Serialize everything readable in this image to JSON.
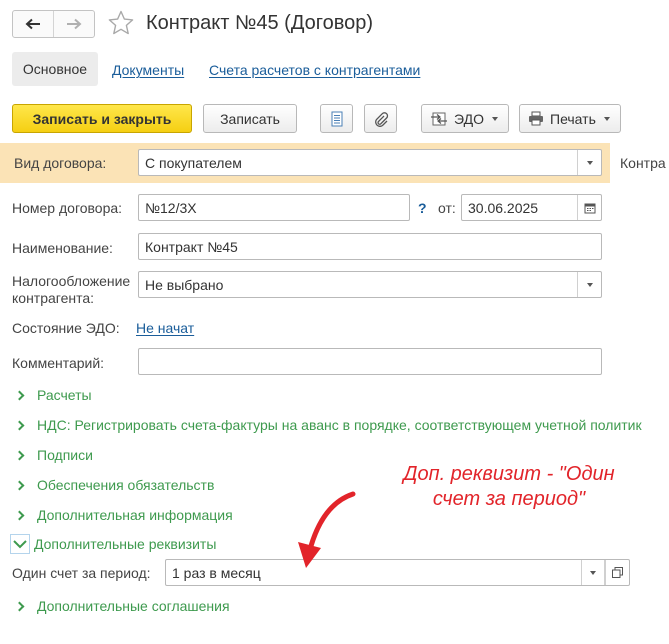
{
  "header": {
    "title": "Контракт №45 (Договор)",
    "back_icon": "arrow-left-icon",
    "forward_icon": "arrow-right-icon",
    "favorite_icon": "star-icon"
  },
  "tabs": [
    {
      "label": "Основное",
      "active": true
    },
    {
      "label": "Документы",
      "active": false
    },
    {
      "label": "Счета расчетов с контрагентами",
      "active": false
    }
  ],
  "toolbar": {
    "save_close_label": "Записать и закрыть",
    "save_label": "Записать",
    "edo_label": "ЭДО",
    "print_label": "Печать",
    "accent_color": "#f5cf12"
  },
  "form": {
    "contract_type_label": "Вид договора:",
    "contract_type_value": "С покупателем",
    "counterparty_label_cut": "Контра",
    "number_label": "Номер договора:",
    "number_value": "№12/3Х",
    "help_mark": "?",
    "date_label": "от:",
    "date_value": "30.06.2025",
    "name_label": "Наименование:",
    "name_value": "Контракт №45",
    "tax_label_line1": "Налогообложение",
    "tax_label_line2": "контрагента:",
    "tax_value": "Не выбрано",
    "edo_state_label": "Состояние ЭДО:",
    "edo_state_value": "Не начат",
    "comment_label": "Комментарий:",
    "comment_value": ""
  },
  "sections": [
    {
      "label": "Расчеты",
      "expanded": false
    },
    {
      "label": "НДС: Регистрировать счета-фактуры на аванс в порядке, соответствующем учетной политик",
      "expanded": false
    },
    {
      "label": "Подписи",
      "expanded": false
    },
    {
      "label": "Обеспечения обязательств",
      "expanded": false
    },
    {
      "label": "Дополнительная информация",
      "expanded": false
    },
    {
      "label": "Дополнительные реквизиты",
      "expanded": true
    },
    {
      "label": "Дополнительные соглашения",
      "expanded": false
    }
  ],
  "extra": {
    "one_invoice_label": "Один счет за период:",
    "one_invoice_value": "1 раз в месяц"
  },
  "annotation": {
    "line1": "Доп. реквизит - \"Один",
    "line2": "счет за период\"",
    "color": "#e2242a"
  },
  "colors": {
    "link": "#1a5d9a",
    "section_green": "#3e9a4e",
    "highlight_row": "#fbe3b6"
  }
}
